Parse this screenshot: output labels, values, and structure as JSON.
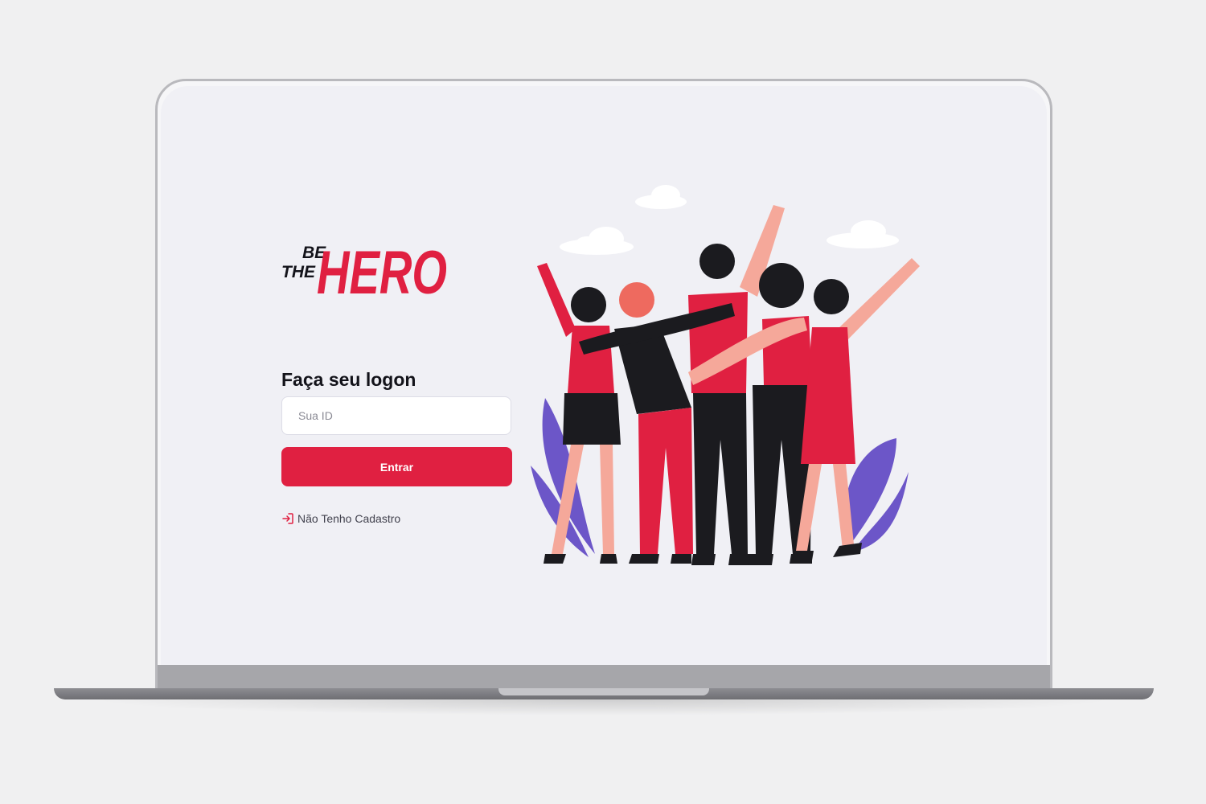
{
  "app": {
    "logo": {
      "line1": "BE",
      "line2": "THE",
      "line3": "HERO"
    },
    "brand_color": "#e02041",
    "text_dark": "#13131a",
    "text_body": "#41414d"
  },
  "logon": {
    "title": "Faça seu logon",
    "id_input": {
      "placeholder": "Sua ID",
      "value": ""
    },
    "submit_label": "Entrar",
    "register_link": {
      "label": "Não Tenho Cadastro",
      "icon": "log-in-icon"
    }
  },
  "illustration": {
    "icon": "friends-hugging-illustration"
  }
}
